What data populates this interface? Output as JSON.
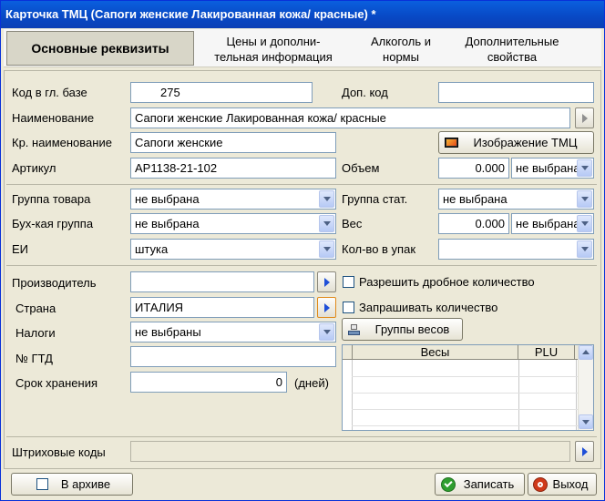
{
  "window": {
    "title": "Карточка ТМЦ (Сапоги женские Лакированная кожа/ красные) *"
  },
  "tabs": [
    {
      "label": "Основные реквизиты",
      "active": true
    },
    {
      "label": "Цены и дополни-\nтельная информация",
      "active": false
    },
    {
      "label": "Алкоголь и\nнормы",
      "active": false
    },
    {
      "label": "Дополнительные\nсвойства",
      "active": false
    }
  ],
  "main": {
    "code_label": "Код в гл. базе",
    "code_value": "275",
    "addcode_label": "Доп. код",
    "addcode_value": "",
    "name_label": "Наименование",
    "name_value": "Сапоги женские Лакированная кожа/ красные",
    "shortname_label": "Кр. наименование",
    "shortname_value": "Сапоги женские",
    "image_button": "Изображение ТМЦ",
    "article_label": "Артикул",
    "article_value": "АР1138-21-102",
    "volume_label": "Объем",
    "volume_value": "0.000",
    "volume_unit": "не выбрана"
  },
  "groups": {
    "product_group_label": "Группа товара",
    "product_group_value": "не выбрана",
    "stat_group_label": "Группа стат.",
    "stat_group_value": "не выбрана",
    "acc_group_label": "Бух-кая группа",
    "acc_group_value": "не выбрана",
    "weight_label": "Вес",
    "weight_value": "0.000",
    "weight_unit": "не выбрана",
    "unit_label": "ЕИ",
    "unit_value": "штука",
    "pack_label": "Кол-во в упак",
    "pack_value": ""
  },
  "extra": {
    "manufacturer_label": "Производитель",
    "manufacturer_value": "",
    "country_label": "Страна",
    "country_value": "ИТАЛИЯ",
    "taxes_label": "Налоги",
    "taxes_value": "не выбраны",
    "gtd_label": "№ ГТД",
    "gtd_value": "",
    "shelf_label": "Срок хранения",
    "shelf_value": "0",
    "shelf_unit": "(дней)",
    "fraction_label": "Разрешить дробное количество",
    "ask_qty_label": "Запрашивать количество",
    "weight_groups_button": "Группы весов",
    "grid_columns": [
      "Весы",
      "PLU"
    ]
  },
  "barcodes": {
    "label": "Штриховые коды",
    "value": ""
  },
  "footer": {
    "archive_label": "В архиве",
    "save_label": "Записать",
    "exit_label": "Выход"
  },
  "colors": {
    "titlebar": "#0848c4",
    "window_bg": "#ece9d8",
    "accent_arrow": "#1f4fd8",
    "save_icon": "#2f9e2f",
    "exit_icon": "#d03a1a"
  }
}
